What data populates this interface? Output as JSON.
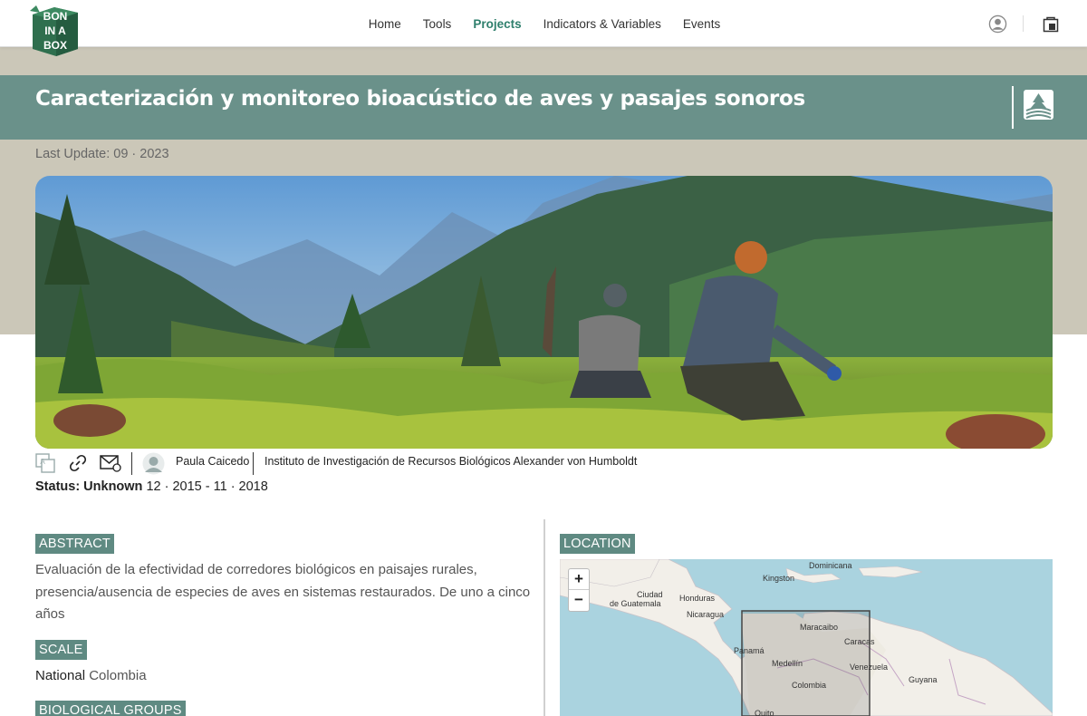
{
  "nav": {
    "items": [
      "Home",
      "Tools",
      "Projects",
      "Indicators & Variables",
      "Events"
    ],
    "active": "Projects",
    "logo_text": [
      "BON",
      "IN A",
      "BOX"
    ]
  },
  "project": {
    "title": "Caracterización y monitoreo bioacústico de aves y pasajes sonoros",
    "last_update": "Last Update: 09 · 2023",
    "author": "Paula Caicedo",
    "institution": "Instituto de Investigación de Recursos Biológicos Alexander von Humboldt",
    "status_label": "Status: Unknown",
    "dates": " 12 · 2015 - 11 · 2018"
  },
  "abstract": {
    "label": "ABSTRACT",
    "text": "Evaluación de la efectividad de corredores biológicos en paisajes rurales, presencia/ausencia de especies de aves en sistemas restaurados. De uno a cinco años"
  },
  "scale": {
    "label": "SCALE",
    "level": "National",
    "country": " Colombia"
  },
  "bio_groups": {
    "label": "BIOLOGICAL GROUPS"
  },
  "location": {
    "label": "LOCATION",
    "zoom_in": "+",
    "zoom_out": "−",
    "places": {
      "dominicana": "Dominicana",
      "kingston": "Kingston",
      "ciudad": "Ciudad",
      "guatemala": "de Guatemala",
      "honduras": "Honduras",
      "nicaragua": "Nicaragua",
      "maracaibo": "Maracaibo",
      "caracas": "Caracas",
      "panama": "Panamá",
      "medellin": "Medellín",
      "venezuela": "Venezuela",
      "colombia": "Colombia",
      "guyana": "Guyana",
      "quito": "Quito"
    }
  },
  "icons": [
    "translate-icon",
    "link-icon",
    "email-icon",
    "user-avatar-icon",
    "account-icon",
    "cart-icon",
    "project-badge-icon"
  ],
  "colors": {
    "accent": "#2e7f6c",
    "title_bar": "#6a918a",
    "beige": "#cbc7b8",
    "label_bg": "#5f8a82",
    "water": "#aad3df"
  }
}
